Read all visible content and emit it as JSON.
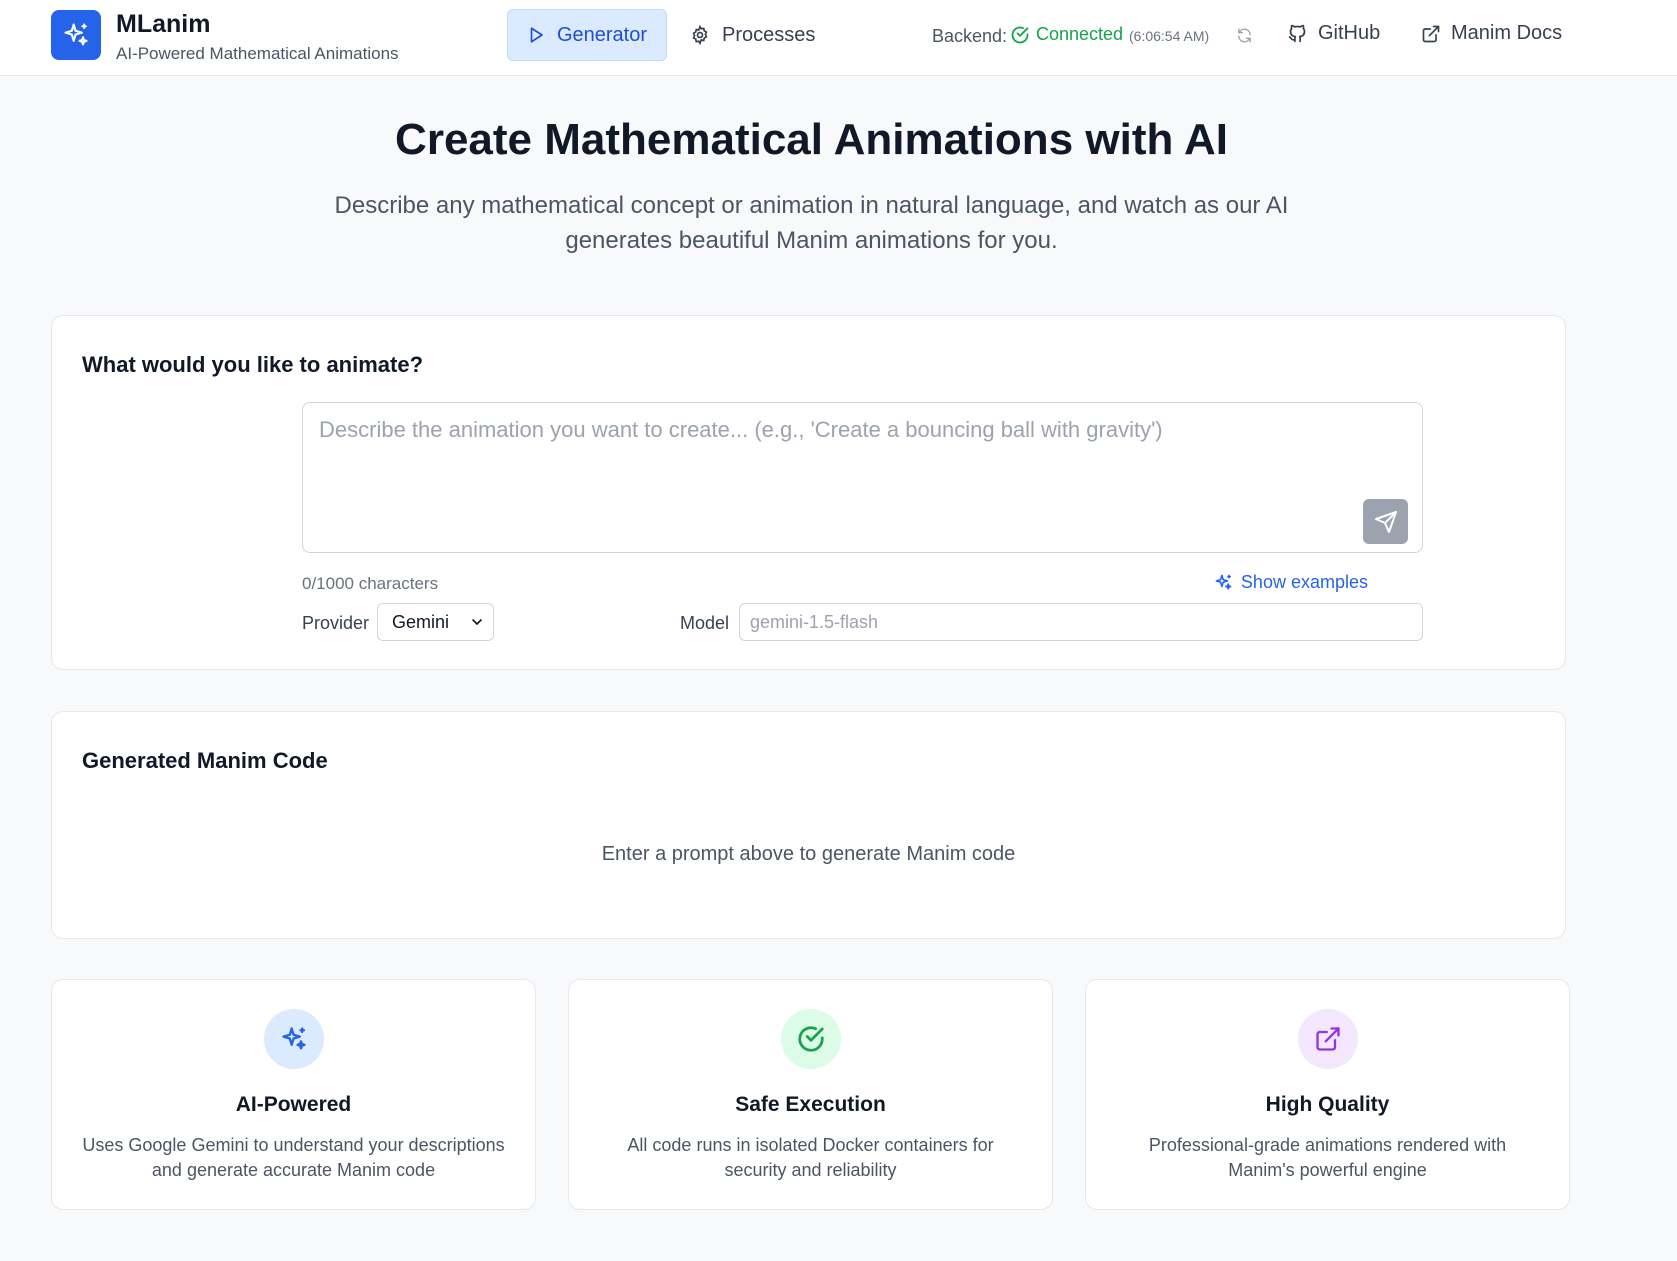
{
  "header": {
    "brand_name": "MLanim",
    "brand_subtitle": "AI-Powered Mathematical Animations",
    "nav": {
      "generator_label": "Generator",
      "processes_label": "Processes"
    },
    "backend": {
      "label": "Backend:",
      "status": "Connected",
      "time": "(6:06:54 AM)"
    },
    "github_label": "GitHub",
    "docs_label": "Manim Docs"
  },
  "hero": {
    "title": "Create Mathematical Animations with AI",
    "subtitle": "Describe any mathematical concept or animation in natural language, and watch as our AI generates beautiful Manim animations for you."
  },
  "prompt_card": {
    "title": "What would you like to animate?",
    "placeholder": "Describe the animation you want to create... (e.g., 'Create a bouncing ball with gravity')",
    "value": "",
    "char_count": "0/1000 characters",
    "show_examples": "Show examples",
    "provider_label": "Provider",
    "provider_value": "Gemini",
    "model_label": "Model",
    "model_placeholder": "gemini-1.5-flash"
  },
  "code_card": {
    "title": "Generated Manim Code",
    "empty_text": "Enter a prompt above to generate Manim code"
  },
  "features": [
    {
      "title": "AI-Powered",
      "description": "Uses Google Gemini to understand your descriptions and generate accurate Manim code",
      "icon": "sparkles-icon"
    },
    {
      "title": "Safe Execution",
      "description": "All code runs in isolated Docker containers for security and reliability",
      "icon": "check-circle-icon"
    },
    {
      "title": "High Quality",
      "description": "Professional-grade animations rendered with Manim's powerful engine",
      "icon": "external-link-icon"
    }
  ],
  "colors": {
    "accent": "#2563eb",
    "success": "#16a34a",
    "purple": "#9333ea",
    "background": "#f8f9fb"
  }
}
